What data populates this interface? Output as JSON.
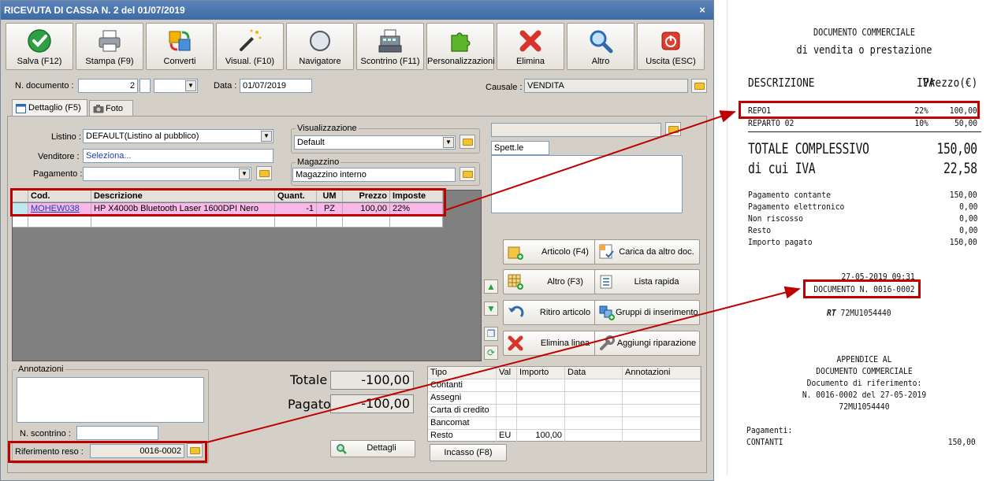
{
  "window": {
    "title": "RICEVUTA DI CASSA N. 2 del 01/07/2019",
    "close": "×"
  },
  "toolbar": [
    {
      "label": "Salva (F12)",
      "icon": "check-icon"
    },
    {
      "label": "Stampa (F9)",
      "icon": "printer-icon"
    },
    {
      "label": "Converti",
      "icon": "convert-icon"
    },
    {
      "label": "Visual. (F10)",
      "icon": "magic-wand-icon"
    },
    {
      "label": "Navigatore",
      "icon": "compass-icon"
    },
    {
      "label": "Scontrino (F11)",
      "icon": "cash-register-icon"
    },
    {
      "label": "Personalizzazioni",
      "icon": "puzzle-icon"
    },
    {
      "label": "Elimina",
      "icon": "delete-x-icon"
    },
    {
      "label": "Altro",
      "icon": "magnifier-icon"
    },
    {
      "label": "Uscita (ESC)",
      "icon": "power-icon"
    }
  ],
  "header": {
    "doc_label": "N. documento :",
    "doc_number": "2",
    "data_label": "Data :",
    "data_value": "01/07/2019",
    "causale_label": "Causale :",
    "causale_value": "VENDITA"
  },
  "tabs": [
    {
      "label": "Dettaglio (F5)",
      "icon": "calendar-icon"
    },
    {
      "label": "Foto",
      "icon": "camera-icon"
    }
  ],
  "form": {
    "listino_label": "Listino :",
    "listino_value": "DEFAULT(Listino al pubblico)",
    "venditore_label": "Venditore :",
    "venditore_value": "Seleziona...",
    "pagamento_label": "Pagamento :",
    "pagamento_value": "",
    "visualizzazione_title": "Visualizzazione",
    "visualizzazione_value": "Default",
    "magazzino_title": "Magazzino",
    "magazzino_value": "Magazzino interno",
    "cliente_value": "Spett.le"
  },
  "grid": {
    "headers": [
      "Cod.",
      "Descrizione",
      "Quant.",
      "UM",
      "Prezzo",
      "Imposte"
    ],
    "rows": [
      {
        "cod": "MOHEW038",
        "descrizione": "HP X4000b Bluetooth Laser 1600DPI Nero",
        "quant": "-1",
        "um": "PZ",
        "prezzo": "100,00",
        "imposte": "22%"
      }
    ]
  },
  "side_buttons": [
    {
      "label": "Articolo (F4)",
      "icon": "box-add-icon"
    },
    {
      "label": "Carica da altro doc.",
      "icon": "document-check-icon"
    },
    {
      "label": "Altro (F3)",
      "icon": "grid-add-icon"
    },
    {
      "label": "Lista rapida",
      "icon": "list-icon"
    },
    {
      "label": "Ritiro articolo",
      "icon": "undo-icon"
    },
    {
      "label": "Gruppi di inserimento",
      "icon": "group-add-icon"
    },
    {
      "label": "Elimina linea",
      "icon": "delete-x-icon"
    },
    {
      "label": "Aggiungi riparazione",
      "icon": "wrench-icon"
    }
  ],
  "annotazioni": {
    "title": "Annotazioni",
    "scontrino_label": "N. scontrino :",
    "scontrino_value": "",
    "riferimento_label": "Riferimento reso :",
    "riferimento_value": "0016-0002"
  },
  "totals": {
    "totale_label": "Totale",
    "totale_value": "-100,00",
    "pagato_label": "Pagato",
    "pagato_value": "-100,00",
    "dettagli_label": "Dettagli"
  },
  "payments": {
    "headers": [
      "Tipo",
      "Val",
      "Importo",
      "Data",
      "Annotazioni"
    ],
    "rows": [
      {
        "tipo": "Contanti",
        "val": "",
        "importo": ""
      },
      {
        "tipo": "Assegni",
        "val": "",
        "importo": ""
      },
      {
        "tipo": "Carta di credito",
        "val": "",
        "importo": ""
      },
      {
        "tipo": "Bancomat",
        "val": "",
        "importo": ""
      },
      {
        "tipo": "Resto",
        "val": "EU",
        "importo": "100,00"
      }
    ],
    "incasso_label": "Incasso (F8)"
  },
  "receipt": {
    "title1": "DOCUMENTO COMMERCIALE",
    "title2": "di vendita o prestazione",
    "col_desc": "DESCRIZIONE",
    "col_iva": "IVA",
    "col_price": "Prezzo(€)",
    "items": [
      {
        "desc": "REPO1",
        "iva": "22%",
        "price": "100,00"
      },
      {
        "desc": "REPARTO 02",
        "iva": "10%",
        "price": "50,00"
      }
    ],
    "totale_label": "TOTALE COMPLESSIVO",
    "totale_value": "150,00",
    "iva_label": "di cui IVA",
    "iva_value": "22,58",
    "payments": [
      {
        "label": "Pagamento contante",
        "value": "150,00"
      },
      {
        "label": "Pagamento elettronico",
        "value": "0,00"
      },
      {
        "label": "Non riscosso",
        "value": "0,00"
      },
      {
        "label": "Resto",
        "value": "0,00"
      },
      {
        "label": "Importo pagato",
        "value": "150,00"
      }
    ],
    "datetime": "27-05-2019 09:31",
    "doc_number": "DOCUMENTO N. 0016-0002",
    "rt_code": "72MU1054440",
    "appendix": [
      "APPENDICE AL",
      "DOCUMENTO COMMERCIALE",
      "Documento di riferimento:",
      "N. 0016-0002 del 27-05-2019",
      "72MU1054440"
    ],
    "pagamenti_label": "Pagamenti:",
    "contanti_label": "CONTANTI",
    "contanti_value": "150,00"
  },
  "colors": {
    "highlight_row": "#f9b9e8",
    "annotation_red": "#c00000",
    "titlebar": "#3d6aa6"
  }
}
